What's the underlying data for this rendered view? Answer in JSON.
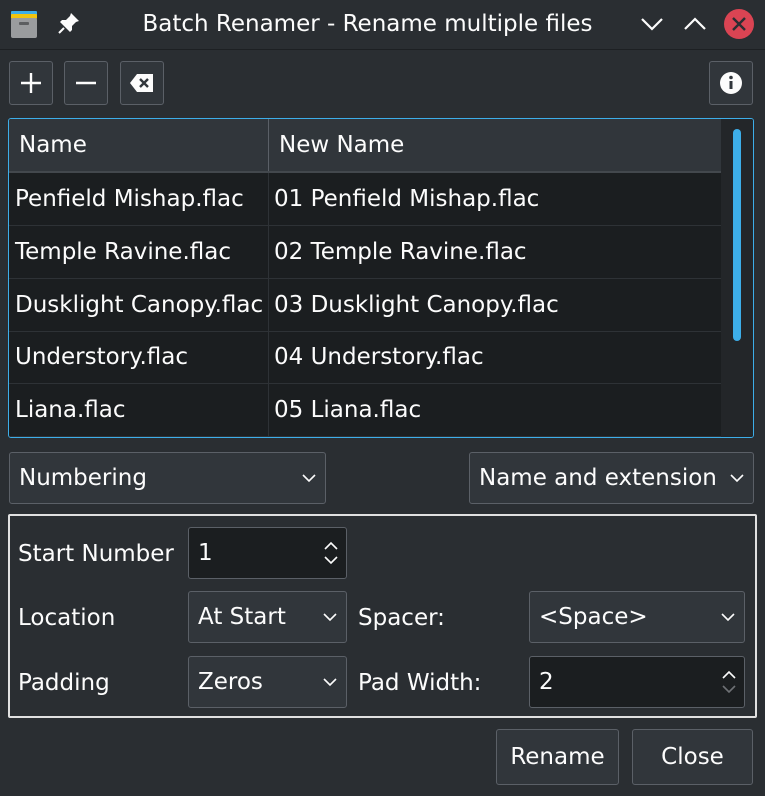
{
  "window": {
    "title": "Batch Renamer - Rename multiple files"
  },
  "icons": {
    "app": "file-cabinet-icon",
    "pin": "pin-icon",
    "minimize": "chevron-down-icon",
    "maximize": "chevron-up-icon",
    "close": "close-icon",
    "add": "plus-icon",
    "remove": "minus-icon",
    "clear": "backspace-icon",
    "info": "info-icon"
  },
  "colors": {
    "accent": "#3daee9",
    "close": "#da4453",
    "background": "#2a2e32"
  },
  "table": {
    "headers": {
      "name": "Name",
      "new_name": "New Name"
    },
    "rows": [
      {
        "name": "Penfield Mishap.flac",
        "new_name": "01 Penfield Mishap.flac"
      },
      {
        "name": "Temple Ravine.flac",
        "new_name": "02 Temple Ravine.flac"
      },
      {
        "name": "Dusklight Canopy.flac",
        "new_name": "03 Dusklight Canopy.flac"
      },
      {
        "name": "Understory.flac",
        "new_name": "04 Understory.flac"
      },
      {
        "name": "Liana.flac",
        "new_name": "05 Liana.flac"
      }
    ]
  },
  "mode_select": {
    "value": "Numbering"
  },
  "scope_select": {
    "value": "Name and extension"
  },
  "numbering": {
    "start_number": {
      "label": "Start Number",
      "value": "1"
    },
    "location": {
      "label": "Location",
      "value": "At Start"
    },
    "spacer": {
      "label": "Spacer:",
      "value": "<Space>"
    },
    "padding": {
      "label": "Padding",
      "value": "Zeros"
    },
    "pad_width": {
      "label": "Pad Width:",
      "value": "2"
    }
  },
  "buttons": {
    "rename": "Rename",
    "close": "Close"
  }
}
